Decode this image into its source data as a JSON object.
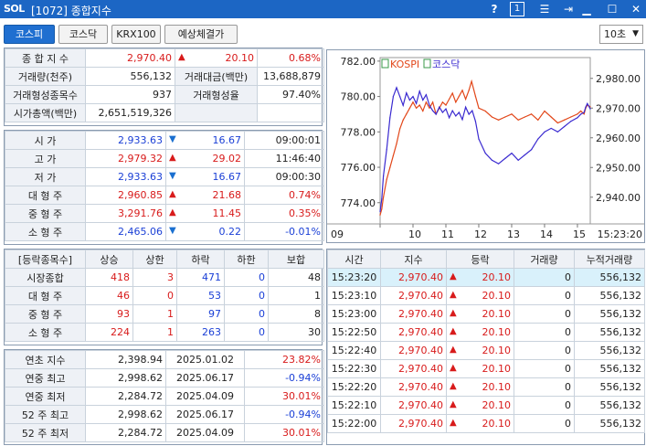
{
  "window": {
    "logo": "SOL",
    "title": "[1072] 종합지수",
    "help": "?",
    "badge": "1"
  },
  "tabs": [
    {
      "label": "코스피"
    },
    {
      "label": "코스닥"
    },
    {
      "label": "KRX100"
    },
    {
      "label": "예상체결가"
    }
  ],
  "interval": "10초",
  "summary": {
    "row1": {
      "label": "종 합 지 수",
      "value": "2,970.40",
      "change": "20.10",
      "pct": "0.68%"
    },
    "row2": {
      "l1": "거래량(천주)",
      "v1": "556,132",
      "l2": "거래대금(백만)",
      "v2": "13,688,879"
    },
    "row3": {
      "l1": "거래형성종목수",
      "v1": "937",
      "l2": "거래형성율",
      "v2": "97.40%"
    },
    "row4": {
      "label": "시가총액(백만)",
      "value": "2,651,519,326"
    }
  },
  "prices": [
    {
      "label": "시  가",
      "value": "2,933.63",
      "dir": "down",
      "change": "16.67",
      "extra": "09:00:01"
    },
    {
      "label": "고  가",
      "value": "2,979.32",
      "dir": "up",
      "change": "29.02",
      "extra": "11:46:40"
    },
    {
      "label": "저  가",
      "value": "2,933.63",
      "dir": "down",
      "change": "16.67",
      "extra": "09:00:30"
    },
    {
      "label": "대 형 주",
      "value": "2,960.85",
      "dir": "up",
      "change": "21.68",
      "extra": "0.74%"
    },
    {
      "label": "중 형 주",
      "value": "3,291.76",
      "dir": "up",
      "change": "11.45",
      "extra": "0.35%"
    },
    {
      "label": "소 형 주",
      "value": "2,465.06",
      "dir": "down",
      "change": "0.22",
      "extra": "-0.01%"
    }
  ],
  "breadth": {
    "headers": [
      "[등락종목수]",
      "상승",
      "상한",
      "하락",
      "하한",
      "보합"
    ],
    "rows": [
      {
        "label": "시장종합",
        "up": "418",
        "upper": "3",
        "down": "471",
        "lower": "0",
        "flat": "48"
      },
      {
        "label": "대 형 주",
        "up": "46",
        "upper": "0",
        "down": "53",
        "lower": "0",
        "flat": "1"
      },
      {
        "label": "중 형 주",
        "up": "93",
        "upper": "1",
        "down": "97",
        "lower": "0",
        "flat": "8"
      },
      {
        "label": "소 형 주",
        "up": "224",
        "upper": "1",
        "down": "263",
        "lower": "0",
        "flat": "30"
      }
    ]
  },
  "extremes": [
    {
      "label": "연초  지수",
      "value": "2,398.94",
      "date": "2025.01.02",
      "pct": "23.82%"
    },
    {
      "label": "연중  최고",
      "value": "2,998.62",
      "date": "2025.06.17",
      "pct": "-0.94%"
    },
    {
      "label": "연중  최저",
      "value": "2,284.72",
      "date": "2025.04.09",
      "pct": "30.01%"
    },
    {
      "label": "52 주 최고",
      "value": "2,998.62",
      "date": "2025.06.17",
      "pct": "-0.94%"
    },
    {
      "label": "52 주 최저",
      "value": "2,284.72",
      "date": "2025.04.09",
      "pct": "30.01%"
    }
  ],
  "ticks_table": {
    "headers": [
      "시간",
      "지수",
      "등락",
      "거래량",
      "누적거래량"
    ],
    "rows": [
      {
        "time": "15:23:20",
        "index": "2,970.40",
        "change": "20.10",
        "vol": "0",
        "cum": "556,132"
      },
      {
        "time": "15:23:10",
        "index": "2,970.40",
        "change": "20.10",
        "vol": "0",
        "cum": "556,132"
      },
      {
        "time": "15:23:00",
        "index": "2,970.40",
        "change": "20.10",
        "vol": "0",
        "cum": "556,132"
      },
      {
        "time": "15:22:50",
        "index": "2,970.40",
        "change": "20.10",
        "vol": "0",
        "cum": "556,132"
      },
      {
        "time": "15:22:40",
        "index": "2,970.40",
        "change": "20.10",
        "vol": "0",
        "cum": "556,132"
      },
      {
        "time": "15:22:30",
        "index": "2,970.40",
        "change": "20.10",
        "vol": "0",
        "cum": "556,132"
      },
      {
        "time": "15:22:20",
        "index": "2,970.40",
        "change": "20.10",
        "vol": "0",
        "cum": "556,132"
      },
      {
        "time": "15:22:10",
        "index": "2,970.40",
        "change": "20.10",
        "vol": "0",
        "cum": "556,132"
      },
      {
        "time": "15:22:00",
        "index": "2,970.40",
        "change": "20.10",
        "vol": "0",
        "cum": "556,132"
      }
    ]
  },
  "chart_data": {
    "type": "line",
    "legend": [
      "KOSPI",
      "코스닥"
    ],
    "left_axis": {
      "ticks": [
        "782.00",
        "780.00",
        "778.00",
        "776.00",
        "774.00"
      ],
      "range": [
        772.8,
        782.2
      ]
    },
    "right_axis": {
      "ticks": [
        "2,980.00",
        "2,970.00",
        "2,960.00",
        "2,950.00",
        "2,940.00"
      ],
      "range": [
        2931,
        2987
      ]
    },
    "x_ticks": [
      "09",
      "10",
      "11",
      "12",
      "13",
      "14",
      "15"
    ],
    "x_end_label": "15:23:20",
    "series": [
      {
        "name": "KOSPI",
        "axis": "right",
        "color": "#e2471a",
        "x": [
          9.0,
          9.05,
          9.1,
          9.2,
          9.3,
          9.4,
          9.5,
          9.6,
          9.7,
          9.8,
          9.9,
          10.0,
          10.1,
          10.2,
          10.3,
          10.4,
          10.5,
          10.6,
          10.7,
          10.8,
          10.9,
          11.0,
          11.1,
          11.2,
          11.3,
          11.4,
          11.5,
          11.6,
          11.7,
          11.78,
          11.9,
          12.0,
          12.2,
          12.4,
          12.6,
          12.8,
          13.0,
          13.2,
          13.4,
          13.6,
          13.8,
          14.0,
          14.2,
          14.4,
          14.6,
          14.8,
          15.0,
          15.1,
          15.2,
          15.25,
          15.3,
          15.39
        ],
        "values": [
          2934,
          2936,
          2940,
          2946,
          2950,
          2954,
          2958,
          2963,
          2966,
          2968,
          2970,
          2972,
          2970,
          2971,
          2969,
          2972,
          2970,
          2972,
          2968,
          2970,
          2972,
          2971,
          2973,
          2975,
          2972,
          2974,
          2976,
          2973,
          2976,
          2979,
          2974,
          2970,
          2969,
          2967,
          2966,
          2967,
          2968,
          2966,
          2967,
          2968,
          2966,
          2969,
          2967,
          2965,
          2966,
          2967,
          2968,
          2969,
          2968,
          2970,
          2971,
          2970.4
        ]
      },
      {
        "name": "코스닥",
        "axis": "left",
        "color": "#3a2ad0",
        "x": [
          9.0,
          9.05,
          9.1,
          9.2,
          9.3,
          9.4,
          9.5,
          9.6,
          9.7,
          9.8,
          9.9,
          10.0,
          10.1,
          10.2,
          10.3,
          10.4,
          10.5,
          10.6,
          10.7,
          10.8,
          10.9,
          11.0,
          11.1,
          11.2,
          11.3,
          11.4,
          11.5,
          11.6,
          11.7,
          11.8,
          11.9,
          12.0,
          12.2,
          12.4,
          12.6,
          12.8,
          13.0,
          13.2,
          13.4,
          13.6,
          13.8,
          14.0,
          14.2,
          14.4,
          14.6,
          14.8,
          15.0,
          15.1,
          15.2,
          15.25,
          15.3,
          15.39
        ],
        "values": [
          773.5,
          774.2,
          775.5,
          777.0,
          778.8,
          780.0,
          780.5,
          780.0,
          779.5,
          780.2,
          779.8,
          780.0,
          779.6,
          780.3,
          779.8,
          780.1,
          779.5,
          779.2,
          779.0,
          779.4,
          779.1,
          779.3,
          778.8,
          779.2,
          778.9,
          779.1,
          778.7,
          779.4,
          779.0,
          779.2,
          778.6,
          777.6,
          776.8,
          776.4,
          776.2,
          776.5,
          776.8,
          776.4,
          776.7,
          777.0,
          777.6,
          778.0,
          778.2,
          778.0,
          778.3,
          778.6,
          778.8,
          779.0,
          779.1,
          779.4,
          779.6,
          779.3
        ]
      }
    ]
  }
}
